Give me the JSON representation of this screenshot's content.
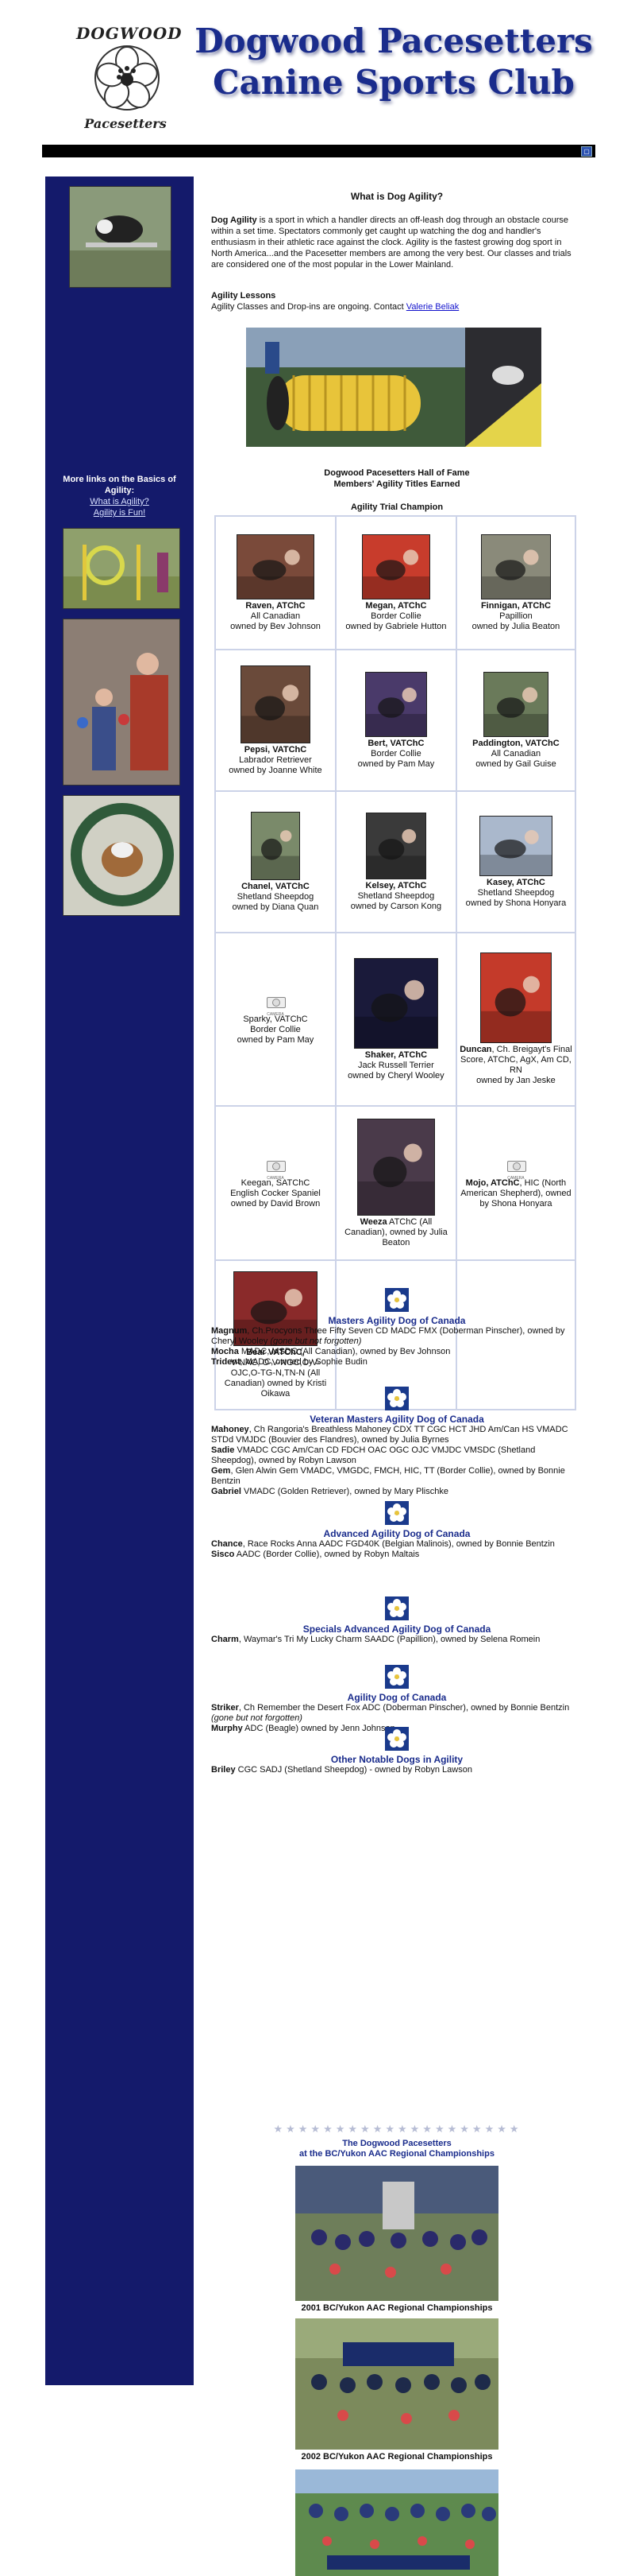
{
  "logo": {
    "word_top": "DOGWOOD",
    "word_bottom": "Pacesetters"
  },
  "site_title": {
    "line1": "Dogwood Pacesetters",
    "line2": "Canine Sports Club"
  },
  "colors": {
    "sidebar": "#141a6b",
    "title": "#1a2c8c",
    "topbar": "#000000",
    "grid_border": "#ccd3e8"
  },
  "sidebar": {
    "links_title": "More links on the Basics of Agility:",
    "links": [
      {
        "label": "What is Agility?"
      },
      {
        "label": "Agility is Fun!"
      }
    ]
  },
  "main": {
    "heading": "What is Dog Agility?",
    "intro_bold": "Dog Agility",
    "intro_text": " is a sport in which a handler directs an off-leash dog through an obstacle course within a set time. Spectators commonly get caught up watching the dog and handler's enthusiasm in their athletic race against the clock. Agility is the fastest growing dog sport in North America...and the Pacesetter members are among the very best. Our classes and trials are considered one of the most popular in the Lower Mainland.",
    "lessons_title": "Agility Lessons",
    "lessons_text": "Agility Classes and Drop-ins are ongoing. Contact ",
    "lessons_contact": "Valerie Beliak",
    "hof_title_line1": "Dogwood Pacesetters Hall of Fame",
    "hof_title_line2": "Members'  Agility Titles Earned",
    "atc_title": "Agility Trial Champion",
    "camera_text": "CAMERA",
    "champions": [
      {
        "name": "Raven, ATChC",
        "desc": "All Canadian",
        "owner": "owned by Bev Johnson",
        "photo": true
      },
      {
        "name": "Megan, ATChC",
        "desc": "Border Collie",
        "owner": "owned by Gabriele Hutton",
        "photo": true
      },
      {
        "name": "Finnigan, ATChC",
        "desc": "Papillion",
        "owner": "owned by Julia Beaton",
        "photo": true
      },
      {
        "name": "Pepsi, VATChC",
        "desc": "Labrador Retriever",
        "owner": "owned by Joanne White",
        "photo": true
      },
      {
        "name": "Bert, VATChC",
        "desc": "Border Collie",
        "owner": "owned by Pam May",
        "photo": true
      },
      {
        "name": "Paddington, VATChC",
        "desc": "All Canadian",
        "owner": "owned by Gail Guise",
        "photo": true
      },
      {
        "name": "Chanel, VATChC",
        "desc": "Shetland Sheepdog",
        "owner": "owned by  Diana Quan",
        "photo": true
      },
      {
        "name": "Kelsey, ATChC",
        "desc": "Shetland Sheepdog",
        "owner": "owned by Carson Kong",
        "photo": true
      },
      {
        "name": "Kasey, ATChC",
        "desc": "Shetland Sheepdog",
        "owner": "owned by Shona Honyara",
        "photo": true
      },
      {
        "name": "Sparky, VATChC",
        "desc": "Border Collie",
        "owner": "owned by Pam May",
        "photo": false,
        "plain": true
      },
      {
        "name": "Shaker, ATChC",
        "desc": "Jack Russell Terrier",
        "owner": "owned by Cheryl Wooley",
        "photo": true
      },
      {
        "name": "Duncan",
        "desc": ", Ch. Breigayt's Final Score, ATChC, AgX, Am CD, RN",
        "owner": "owned by Jan Jeske",
        "photo": true
      },
      {
        "name": "Keegan, SATChC",
        "desc": "English Cocker Spaniel",
        "owner": "owned by David Brown",
        "photo": false,
        "plain": true
      },
      {
        "name": "Weeza",
        "desc": " ATChC (All Canadian), owned by Julia Beaton",
        "owner": "",
        "photo": true
      },
      {
        "name": "Mojo, ATChC",
        "desc": ", HIC (North American Shepherd), owned by Shona Honyara",
        "owner": "",
        "photo": false
      },
      {
        "name": "Bear VATChC,",
        "desc": "V-NAC, O-V-NGC,O-V-OJC,O-TG-N,TN-N (All Canadian) owned by Kristi Oikawa",
        "owner": "",
        "photo": true
      }
    ],
    "categories": [
      {
        "title": "Masters Agility Dog of Canada",
        "entries": [
          {
            "name": "Magnum",
            "text": ", Ch.Procyons Three Fifty Seven CD MADC FMX (Doberman Pinscher), owned by Cheryl Wooley ",
            "note": "(gone but not forgotten)"
          },
          {
            "name": "Mocha",
            "text": " MADC, MSDC (All Canadian), owned by Bev Johnson",
            "note": ""
          },
          {
            "name": "Trident",
            "text": ", MADC, owned by Sophie Budin",
            "note": ""
          }
        ]
      },
      {
        "title": "Veteran Masters Agility Dog of Canada",
        "entries": [
          {
            "name": "Mahoney",
            "text": ", Ch Rangoria's Breathless Mahoney CDX TT CGC HCT JHD Am/Can HS VMADC STDd VMJDC (Bouvier des Flandres), owned by Julia Byrnes",
            "note": ""
          },
          {
            "name": "Sadie",
            "text": " VMADC CGC Am/Can CD FDCH OAC OGC OJC VMJDC VMSDC (Shetland Sheepdog), owned by Robyn Lawson",
            "note": ""
          },
          {
            "name": "Gem",
            "text": ", Glen Alwin Gem VMADC, VMGDC, FMCH, HIC, TT (Border Collie), owned by Bonnie Bentzin",
            "note": ""
          },
          {
            "name": "Gabriel",
            "text": " VMADC (Golden Retriever), owned by Mary Plischke",
            "note": ""
          }
        ]
      },
      {
        "title": "Advanced Agility Dog of Canada",
        "entries": [
          {
            "name": "Chance",
            "text": ", Race Rocks Anna AADC FGD40K (Belgian Malinois), owned by Bonnie Bentzin",
            "note": ""
          },
          {
            "name": "Sisco",
            "text": " AADC (Border Collie), owned by Robyn Maltais",
            "note": ""
          }
        ]
      },
      {
        "title": "Specials Advanced Agility Dog of Canada",
        "entries": [
          {
            "name": "Charm",
            "text": ", Waymar's Tri My Lucky Charm SAADC (Papillion), owned by Selena Romein",
            "note": ""
          }
        ]
      },
      {
        "title": "Agility Dog of Canada",
        "entries": [
          {
            "name": "Striker",
            "text": ", Ch Remember the Desert Fox ADC (Doberman Pinscher), owned by Bonnie Bentzin ",
            "note": "(gone but not forgotten)"
          },
          {
            "name": "Murphy",
            "text": " ADC (Beagle) owned by Jenn Johnson",
            "note": ""
          }
        ]
      },
      {
        "title": "Other Notable Dogs in Agility",
        "entries": [
          {
            "name": "Briley",
            "text": " CGC SADJ (Shetland Sheepdog) - owned by Robyn Lawson",
            "note": ""
          }
        ]
      }
    ],
    "regional_title_line1": "The Dogwood Pacesetters",
    "regional_title_line2": "at the BC/Yukon AAC Regional Championships",
    "regional_captions": [
      "2001 BC/Yukon AAC Regional Championships",
      "2002 BC/Yukon AAC Regional Championships"
    ]
  }
}
